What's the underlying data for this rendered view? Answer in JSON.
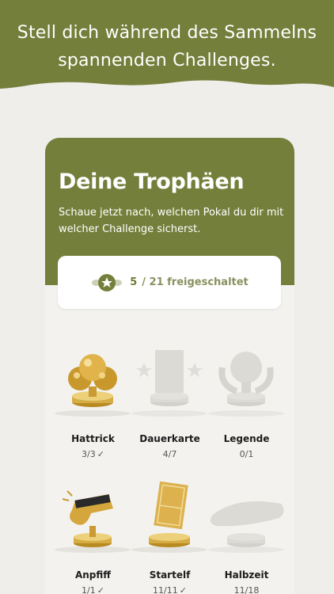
{
  "headline": {
    "line1": "Stell dich während des Sammelns",
    "line2": "spannenden Challenges."
  },
  "card": {
    "title": "Deine Trophäen",
    "subtitle": "Schaue jetzt nach, welchen Pokal du dir mit welcher Challenge sicherst.",
    "progress": {
      "unlocked": "5",
      "rest": "/ 21 freigeschaltet",
      "icon": "laurel-star-icon"
    }
  },
  "trophies": [
    {
      "name": "Hattrick",
      "count": "3/3",
      "done": true,
      "unlocked": true,
      "icon": "golden-balls-trophy"
    },
    {
      "name": "Dauerkarte",
      "count": "4/7",
      "done": false,
      "unlocked": false,
      "icon": "ticket-stars-trophy"
    },
    {
      "name": "Legende",
      "count": "0/1",
      "done": false,
      "unlocked": false,
      "icon": "laurel-wreath-trophy"
    },
    {
      "name": "Anpfiff",
      "count": "1/1",
      "done": true,
      "unlocked": true,
      "icon": "whistle-trophy"
    },
    {
      "name": "Startelf",
      "count": "11/11",
      "done": true,
      "unlocked": true,
      "icon": "pitch-card-trophy"
    },
    {
      "name": "Halbzeit",
      "count": "11/18",
      "done": false,
      "unlocked": false,
      "icon": "sausage-trophy"
    }
  ],
  "colors": {
    "brand": "#747f3b",
    "gold": "#c9a23a",
    "locked": "#d8d6d2",
    "background": "#f0eeea"
  }
}
